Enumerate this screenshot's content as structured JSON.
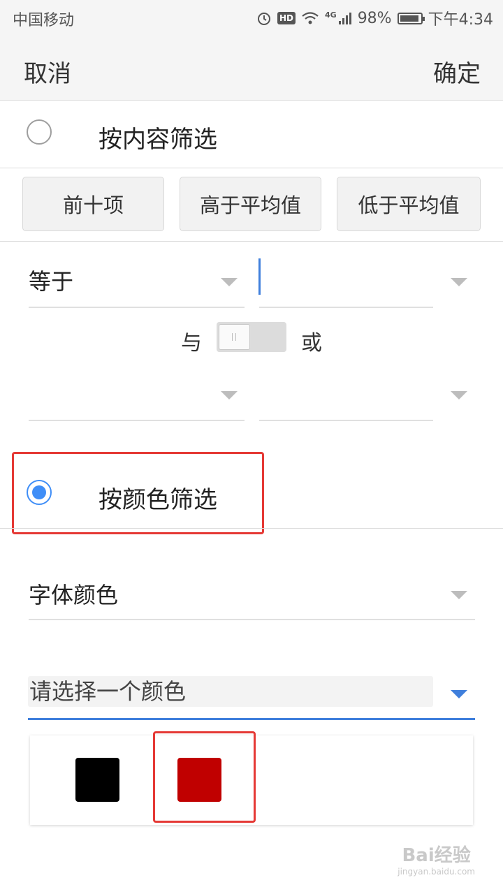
{
  "status_bar": {
    "carrier": "中国移动",
    "hd": "HD",
    "network": "4G",
    "battery": "98%",
    "time": "下午4:34"
  },
  "header": {
    "cancel": "取消",
    "confirm": "确定"
  },
  "filter_by_content": {
    "label": "按内容筛选",
    "selected": false,
    "presets": [
      "前十项",
      "高于平均值",
      "低于平均值"
    ],
    "condition1": {
      "operator": "等于",
      "value": ""
    },
    "logic": {
      "and_label": "与",
      "or_label": "或",
      "state": "与"
    },
    "condition2": {
      "operator": "",
      "value": ""
    }
  },
  "filter_by_color": {
    "label": "按颜色筛选",
    "selected": true,
    "color_type": "字体颜色",
    "color_placeholder": "请选择一个颜色",
    "swatches": [
      {
        "color": "#000000",
        "selected": false
      },
      {
        "color": "#c00000",
        "selected": true
      }
    ]
  },
  "watermark": {
    "brand": "Bai经验",
    "url": "jingyan.baidu.com"
  },
  "colors": {
    "accent": "#3f8ef7",
    "highlight": "#e53935"
  }
}
